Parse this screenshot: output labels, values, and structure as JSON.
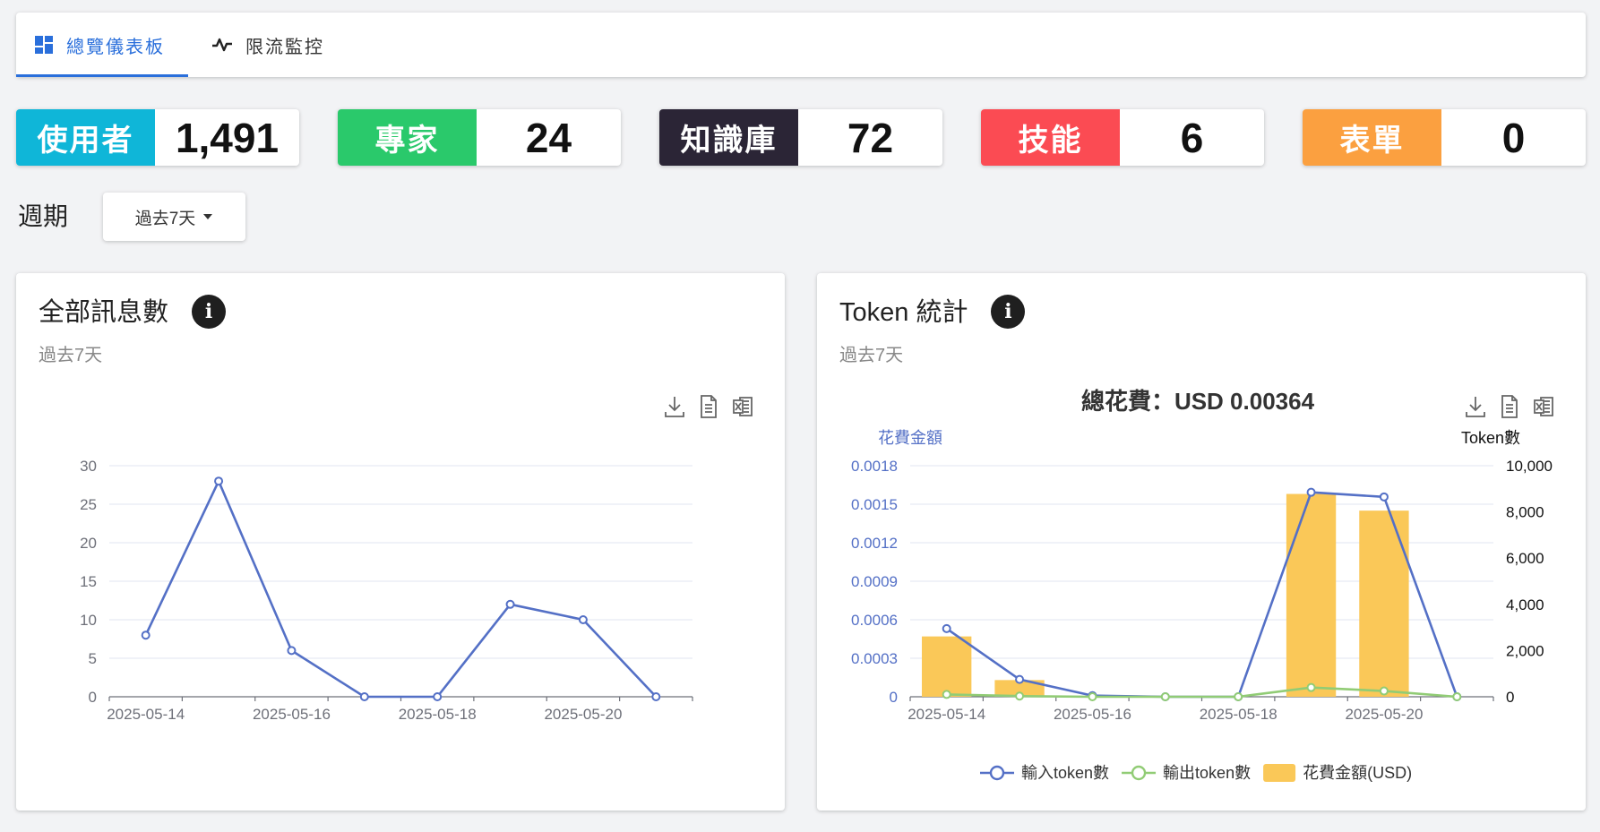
{
  "tabs": [
    {
      "label": "總覽儀表板",
      "icon": "dashboard-icon",
      "active": true
    },
    {
      "label": "限流監控",
      "icon": "activity-icon",
      "active": false
    }
  ],
  "stats": [
    {
      "label": "使用者",
      "value": "1,491",
      "color": "#0fb6d8"
    },
    {
      "label": "專家",
      "value": "24",
      "color": "#2ac96b"
    },
    {
      "label": "知識庫",
      "value": "72",
      "color": "#2b2536"
    },
    {
      "label": "技能",
      "value": "6",
      "color": "#fb4b53"
    },
    {
      "label": "表單",
      "value": "0",
      "color": "#fba040"
    }
  ],
  "period": {
    "label": "週期",
    "selected": "過去7天"
  },
  "messages_card": {
    "title": "全部訊息數",
    "subtitle": "過去7天",
    "chart_data": {
      "type": "line",
      "x": [
        "2025-05-14",
        "2025-05-15",
        "2025-05-16",
        "2025-05-17",
        "2025-05-18",
        "2025-05-19",
        "2025-05-20",
        "2025-05-21"
      ],
      "x_tick_labels": [
        "2025-05-14",
        "2025-05-16",
        "2025-05-18",
        "2025-05-20"
      ],
      "series": [
        {
          "values": [
            8,
            28,
            6,
            0,
            0,
            12,
            10,
            0
          ],
          "color": "#5470c6"
        }
      ],
      "ylim": [
        0,
        30
      ],
      "y_ticks": [
        0,
        5,
        10,
        15,
        20,
        25,
        30
      ],
      "grid": true
    }
  },
  "token_card": {
    "title": "Token 統計",
    "subtitle": "過去7天",
    "chart_data": {
      "type": "bar",
      "title": "總花費：USD 0.00364",
      "x": [
        "2025-05-14",
        "2025-05-15",
        "2025-05-16",
        "2025-05-17",
        "2025-05-18",
        "2025-05-19",
        "2025-05-20",
        "2025-05-21"
      ],
      "x_tick_labels": [
        "2025-05-14",
        "2025-05-16",
        "2025-05-18",
        "2025-05-20"
      ],
      "y_left_label": "花費金額",
      "y_right_label": "Token數",
      "y_left_ticks": [
        "0",
        "0.0003",
        "0.0006",
        "0.0009",
        "0.0012",
        "0.0015",
        "0.0018"
      ],
      "y_left_range": [
        0,
        0.0018
      ],
      "y_right_ticks": [
        "0",
        "2,000",
        "4,000",
        "6,000",
        "8,000",
        "10,000"
      ],
      "y_right_range": [
        0,
        10000
      ],
      "series": [
        {
          "name": "輸入token數",
          "type": "line",
          "axis": "right",
          "color": "#5470c6",
          "values": [
            2950,
            750,
            50,
            0,
            0,
            8850,
            8650,
            0
          ]
        },
        {
          "name": "輸出token數",
          "type": "line",
          "axis": "right",
          "color": "#91cc75",
          "values": [
            100,
            30,
            0,
            0,
            0,
            400,
            250,
            0
          ]
        },
        {
          "name": "花費金額(USD)",
          "type": "bar",
          "axis": "left",
          "color": "#fac858",
          "values": [
            0.00047,
            0.00013,
            0,
            0,
            0,
            0.00158,
            0.00145,
            0
          ]
        }
      ],
      "legend_position": "bottom"
    }
  },
  "toolbox_icons": [
    "download-icon",
    "document-icon",
    "excel-icon"
  ]
}
